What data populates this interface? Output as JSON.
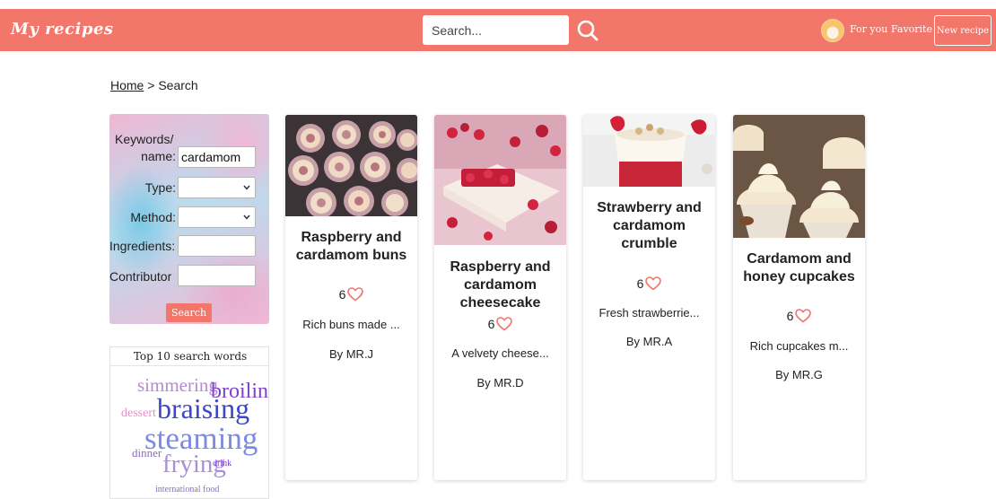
{
  "header": {
    "brand": "My recipes",
    "search_placeholder": "Search...",
    "nav_for_you": "For you",
    "nav_favorite": "Favorite",
    "new_recipe_label": "New recipe",
    "bar_color": "#f2766a"
  },
  "breadcrumb": {
    "home": "Home",
    "separator": " > ",
    "current": "Search"
  },
  "filters": {
    "keywords_label_line1": "Keywords/",
    "keywords_label_line2": "name:",
    "keywords_value": "cardamom",
    "type_label": "Type:",
    "type_value": "",
    "method_label": "Method:",
    "method_value": "",
    "ingredients_label": "Ingredients:",
    "ingredients_value": "",
    "contributor_label": "Contributor",
    "contributor_value": "",
    "search_button": "Search"
  },
  "word_cloud": {
    "title": "Top 10 search words",
    "words": [
      "simmering",
      "broiling",
      "dessert",
      "braising",
      "steaming",
      "dinner",
      "frying",
      "drink",
      "international food"
    ]
  },
  "results": [
    {
      "title": "Raspberry and cardamom buns",
      "likes": "6",
      "description": "Rich buns made ...",
      "author": "By MR.J"
    },
    {
      "title": "Raspberry and cardamom cheesecake",
      "likes": "6",
      "description": "A velvety cheese...",
      "author": "By MR.D"
    },
    {
      "title": "Strawberry and cardamom crumble",
      "likes": "6",
      "description": "Fresh strawberrie...",
      "author": "By MR.A"
    },
    {
      "title": "Cardamom and honey cupcakes",
      "likes": "6",
      "description": "Rich cupcakes m...",
      "author": "By MR.G"
    }
  ]
}
